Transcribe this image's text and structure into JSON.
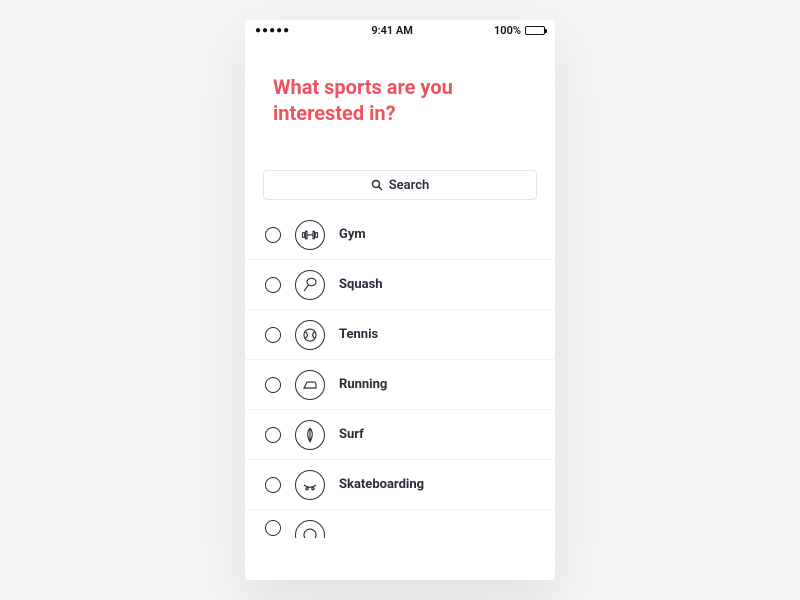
{
  "status_bar": {
    "signal_dots": "●●●●●",
    "time": "9:41 AM",
    "battery_pct": "100%"
  },
  "header": {
    "title": "What sports are you interested in?"
  },
  "search": {
    "placeholder": "Search"
  },
  "sports": [
    {
      "label": "Gym",
      "icon": "gym"
    },
    {
      "label": "Squash",
      "icon": "squash"
    },
    {
      "label": "Tennis",
      "icon": "tennis"
    },
    {
      "label": "Running",
      "icon": "running"
    },
    {
      "label": "Surf",
      "icon": "surf"
    },
    {
      "label": "Skateboarding",
      "icon": "skateboarding"
    }
  ]
}
